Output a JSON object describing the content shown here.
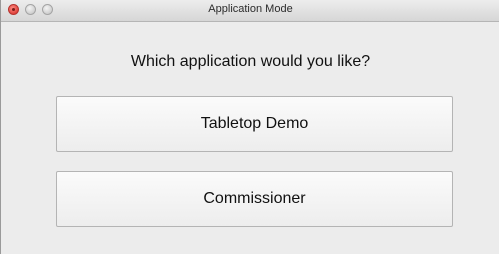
{
  "window": {
    "title": "Application Mode"
  },
  "prompt": {
    "question": "Which application would you like?"
  },
  "options": [
    {
      "label": "Tabletop Demo"
    },
    {
      "label": "Commissioner"
    }
  ]
}
